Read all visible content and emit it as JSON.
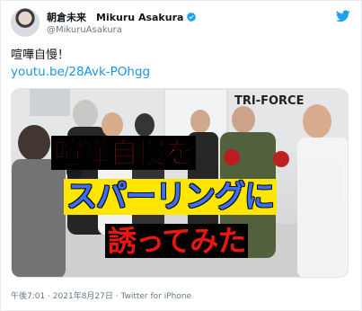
{
  "user": {
    "display_name": "朝倉未来　Mikuru Asakura",
    "handle": "@MikuruAsakura",
    "verified": true
  },
  "tweet": {
    "text": "喧嘩自慢！",
    "link": "youtu.be/28Avk-POhgg",
    "meta": "午後7:01 · 2021年8月27日 · Twitter for iPhone"
  },
  "media": {
    "gym_sign": "TRI-FORCE",
    "caption_lines": [
      "喧嘩自慢を",
      "スパーリングに",
      "誘ってみた"
    ]
  },
  "colors": {
    "link": "#1b95e0",
    "verified": "#1da1f2",
    "caption_red": "#e8180f",
    "caption_blue": "#3b6ff5",
    "caption_yellow": "#ffe600"
  },
  "icons": [
    "avatar",
    "verified-badge-icon",
    "twitter-bird-icon"
  ]
}
